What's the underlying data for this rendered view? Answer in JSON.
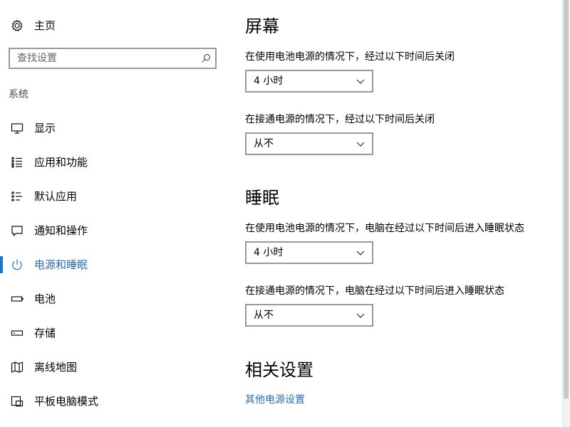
{
  "sidebar": {
    "home_label": "主页",
    "home_icon": "gear-icon",
    "search_placeholder": "查找设置",
    "search_icon": "search-icon",
    "group_label": "系统",
    "active_color": "#1e74c6",
    "items": [
      {
        "label": "显示",
        "icon": "monitor-icon",
        "active": false
      },
      {
        "label": "应用和功能",
        "icon": "apps-list-icon",
        "active": false
      },
      {
        "label": "默认应用",
        "icon": "default-apps-icon",
        "active": false
      },
      {
        "label": "通知和操作",
        "icon": "notification-icon",
        "active": false
      },
      {
        "label": "电源和睡眠",
        "icon": "power-icon",
        "active": true
      },
      {
        "label": "电池",
        "icon": "battery-icon",
        "active": false
      },
      {
        "label": "存储",
        "icon": "storage-icon",
        "active": false
      },
      {
        "label": "离线地图",
        "icon": "map-icon",
        "active": false
      },
      {
        "label": "平板电脑模式",
        "icon": "tablet-mode-icon",
        "active": false
      }
    ]
  },
  "main": {
    "screen": {
      "title": "屏幕",
      "battery_label": "在使用电池电源的情况下，经过以下时间后关闭",
      "battery_value": "4 小时",
      "plugged_label": "在接通电源的情况下，经过以下时间后关闭",
      "plugged_value": "从不"
    },
    "sleep": {
      "title": "睡眠",
      "battery_label": "在使用电池电源的情况下，电脑在经过以下时间后进入睡眠状态",
      "battery_value": "4 小时",
      "plugged_label": "在接通电源的情况下，电脑在经过以下时间后进入睡眠状态",
      "plugged_value": "从不"
    },
    "related": {
      "title": "相关设置",
      "link_label": "其他电源设置",
      "link_color": "#2a6fb5"
    }
  }
}
